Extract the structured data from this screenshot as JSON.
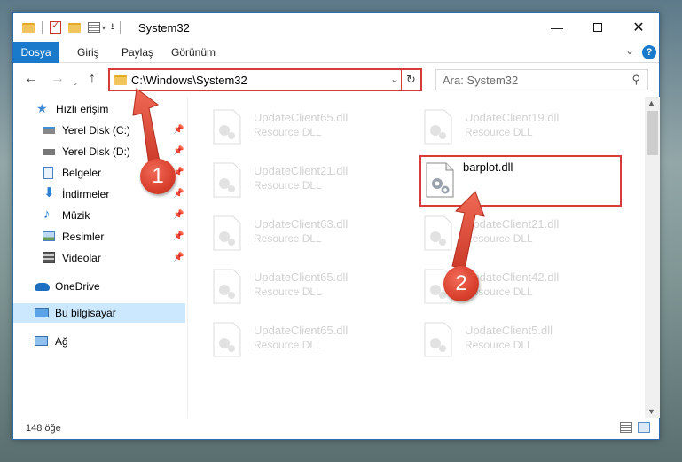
{
  "window": {
    "title": "System32"
  },
  "ribbon": {
    "tabs": [
      "Dosya",
      "Giriş",
      "Paylaş",
      "Görünüm"
    ]
  },
  "address": {
    "path": "C:\\Windows\\System32"
  },
  "search": {
    "placeholder": "Ara: System32"
  },
  "nav": {
    "quick_access": "Hızlı erişim",
    "items": [
      "Yerel Disk (C:)",
      "Yerel Disk (D:)",
      "Belgeler",
      "İndirmeler",
      "Müzik",
      "Resimler",
      "Videolar"
    ],
    "onedrive": "OneDrive",
    "this_pc": "Bu bilgisayar",
    "network": "Ağ"
  },
  "files": [
    {
      "name": "UpdateClient65.dll",
      "type": "Resource DLL"
    },
    {
      "name": "UpdateClient19.dll",
      "type": "Resource DLL"
    },
    {
      "name": "UpdateClient21.dll",
      "type": "Resource DLL"
    },
    {
      "name": "barplot.dll",
      "type": ""
    },
    {
      "name": "UpdateClient63.dll",
      "type": "Resource DLL"
    },
    {
      "name": "UpdateClient21.dll",
      "type": "Resource DLL"
    },
    {
      "name": "UpdateClient65.dll",
      "type": "Resource DLL"
    },
    {
      "name": "UpdateClient42.dll",
      "type": "Resource DLL"
    },
    {
      "name": "UpdateClient65.dll",
      "type": "Resource DLL"
    },
    {
      "name": "UpdateClient5.dll",
      "type": "Resource DLL"
    }
  ],
  "status": {
    "count": "148 öğe"
  },
  "callouts": {
    "one": "1",
    "two": "2"
  },
  "colors": {
    "accent": "#1979ca",
    "highlight": "#d93a3a",
    "selected": "#cce8ff"
  }
}
